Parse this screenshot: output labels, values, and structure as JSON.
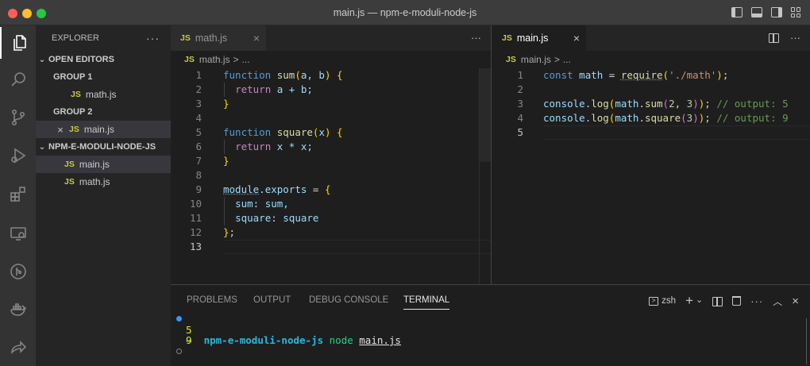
{
  "window": {
    "title": "main.js — npm-e-moduli-node-js"
  },
  "colors": {
    "title_bar": "#3c3c3c",
    "activity_bar": "#333333",
    "sidebar": "#252526",
    "editor": "#1e1e1e",
    "js_badge": "#cbcb41",
    "terminal_prompt": "#23d18b",
    "terminal_cwd": "#29b8db"
  },
  "activity_bar": {
    "items": [
      "explorer-icon",
      "search-icon",
      "source-control-icon",
      "run-debug-icon",
      "extensions-icon",
      "remote-explorer-icon",
      "git-graph-icon",
      "docker-icon",
      "live-share-icon"
    ]
  },
  "sidebar": {
    "title": "EXPLORER",
    "more": "···",
    "open_editors": {
      "label": "OPEN EDITORS",
      "group1": {
        "label": "GROUP 1",
        "files": [
          "math.js"
        ]
      },
      "group2": {
        "label": "GROUP 2",
        "files": [
          "main.js"
        ]
      }
    },
    "project": {
      "label": "NPM-E-MODULI-NODE-JS",
      "files": [
        "main.js",
        "math.js"
      ]
    },
    "js_badge": "JS"
  },
  "editor_left": {
    "tab": {
      "label": "math.js",
      "close": "×"
    },
    "more": "···",
    "breadcrumb": {
      "file": "math.js",
      "sep": ">",
      "rest": "..."
    },
    "lines": [
      "1",
      "2",
      "3",
      "4",
      "5",
      "6",
      "7",
      "8",
      "9",
      "10",
      "11",
      "12",
      "13"
    ],
    "code": {
      "l1": {
        "kw": "function",
        "name": "sum",
        "p_open": "(",
        "params": "a, b",
        "p_close": ")",
        "brace": "{"
      },
      "l2": {
        "kw": "return",
        "expr": "a + b;"
      },
      "l3": {
        "brace": "}"
      },
      "l5": {
        "kw": "function",
        "name": "square",
        "p_open": "(",
        "param": "x",
        "p_close": ")",
        "brace": "{"
      },
      "l6": {
        "kw": "return",
        "expr": "x * x;"
      },
      "l7": {
        "brace": "}"
      },
      "l9": {
        "obj": "module",
        "dot": ".",
        "prop": "exports",
        "eq": " = ",
        "brace": "{"
      },
      "l10": {
        "key": "sum",
        "colon": ": ",
        "val": "sum,"
      },
      "l11": {
        "key": "square",
        "colon": ": ",
        "val": "square"
      },
      "l12": {
        "brace": "}",
        "semi": ";"
      }
    }
  },
  "editor_right": {
    "tab": {
      "label": "main.js",
      "close": "×"
    },
    "more": "···",
    "breadcrumb": {
      "file": "main.js",
      "sep": ">",
      "rest": "..."
    },
    "lines": [
      "1",
      "2",
      "3",
      "4",
      "5"
    ],
    "code": {
      "l1": {
        "kw": "const",
        "name": "math",
        "eq": " = ",
        "fn": "require",
        "p_open": "(",
        "str": "'./math'",
        "p_close": ")",
        "semi": ";"
      },
      "l3": {
        "obj": "console",
        "dot1": ".",
        "log": "log",
        "p_open": "(",
        "math": "math",
        "dot2": ".",
        "fn": "sum",
        "p2_open": "(",
        "a": "2",
        "comma": ", ",
        "b": "3",
        "p2_close": ")",
        "p_close": ")",
        "semi": "; ",
        "comment": "// output: 5"
      },
      "l4": {
        "obj": "console",
        "dot1": ".",
        "log": "log",
        "p_open": "(",
        "math": "math",
        "dot2": ".",
        "fn": "square",
        "p2_open": "(",
        "a": "3",
        "p2_close": ")",
        "p_close": ")",
        "semi": "; ",
        "comment": "// output: 9"
      }
    }
  },
  "panel": {
    "tabs": [
      "PROBLEMS",
      "OUTPUT",
      "DEBUG CONSOLE",
      "TERMINAL"
    ],
    "active_tab": "TERMINAL",
    "shell": "zsh",
    "add": "+",
    "dropdown": "⌄",
    "up": "︿",
    "close": "×",
    "terminal": {
      "prompt_arrow": "→",
      "cwd": "npm-e-moduli-node-js",
      "command": "node",
      "arg": "main.js",
      "output": [
        "5",
        "9"
      ]
    }
  }
}
